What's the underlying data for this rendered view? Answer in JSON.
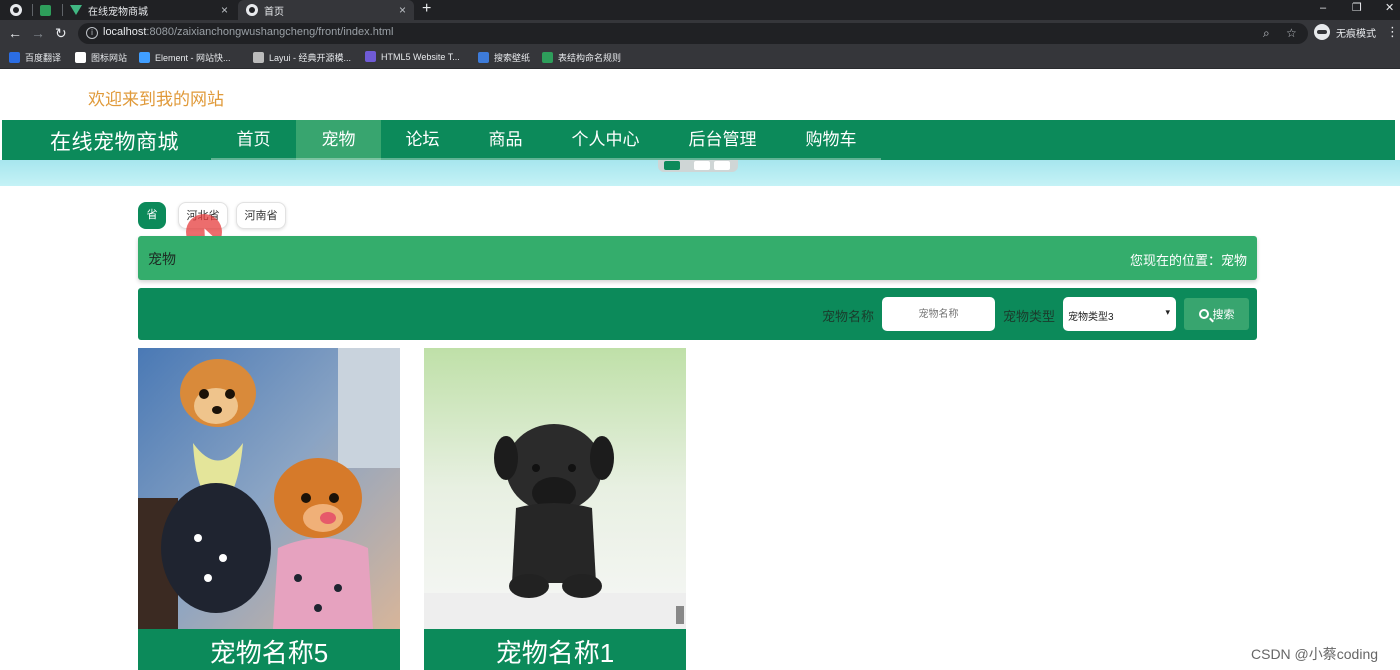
{
  "browser": {
    "tabs": [
      {
        "title": ""
      },
      {
        "title": ""
      },
      {
        "title": "在线宠物商城"
      },
      {
        "title": "首页"
      }
    ],
    "url_host": "localhost",
    "url_rest": ":8080/zaixianchongwushangcheng/front/index.html",
    "incognito_label": "无痕模式",
    "bookmarks": [
      {
        "label": "百度翻译",
        "color": "#2b6de3"
      },
      {
        "label": "图标网站",
        "color": "#ffffff"
      },
      {
        "label": "Element - 网站快...",
        "color": "#409eff"
      },
      {
        "label": "Layui - 经典开源模...",
        "color": "#bbbbbb"
      },
      {
        "label": "HTML5 Website T...",
        "color": "#6f5bd6"
      },
      {
        "label": "搜索壁纸",
        "color": "#3d7bd9"
      },
      {
        "label": "表结构命名规则",
        "color": "#2e9e5b"
      }
    ]
  },
  "site": {
    "welcome": "欢迎来到我的网站",
    "brand": "在线宠物商城",
    "nav": [
      {
        "label": "首页",
        "active": false
      },
      {
        "label": "宠物",
        "active": true
      },
      {
        "label": "论坛",
        "active": false
      },
      {
        "label": "商品",
        "active": false
      },
      {
        "label": "个人中心",
        "active": false
      },
      {
        "label": "后台管理",
        "active": false
      },
      {
        "label": "购物车",
        "active": false
      }
    ],
    "provinces": [
      "省",
      "河北省",
      "河南省"
    ],
    "breadcrumb": {
      "title": "宠物",
      "location": "您现在的位置：宠物"
    },
    "search": {
      "name_label": "宠物名称",
      "name_placeholder": "宠物名称",
      "type_label": "宠物类型",
      "type_value": "宠物类型3",
      "button": "搜索"
    },
    "cards": [
      {
        "name": "宠物名称5"
      },
      {
        "name": "宠物名称1"
      }
    ],
    "watermark": "CSDN @小蔡coding"
  },
  "colors": {
    "primary": "#0c8a5a",
    "primary_light": "#34ad6c",
    "welcome": "#e09a3a"
  }
}
